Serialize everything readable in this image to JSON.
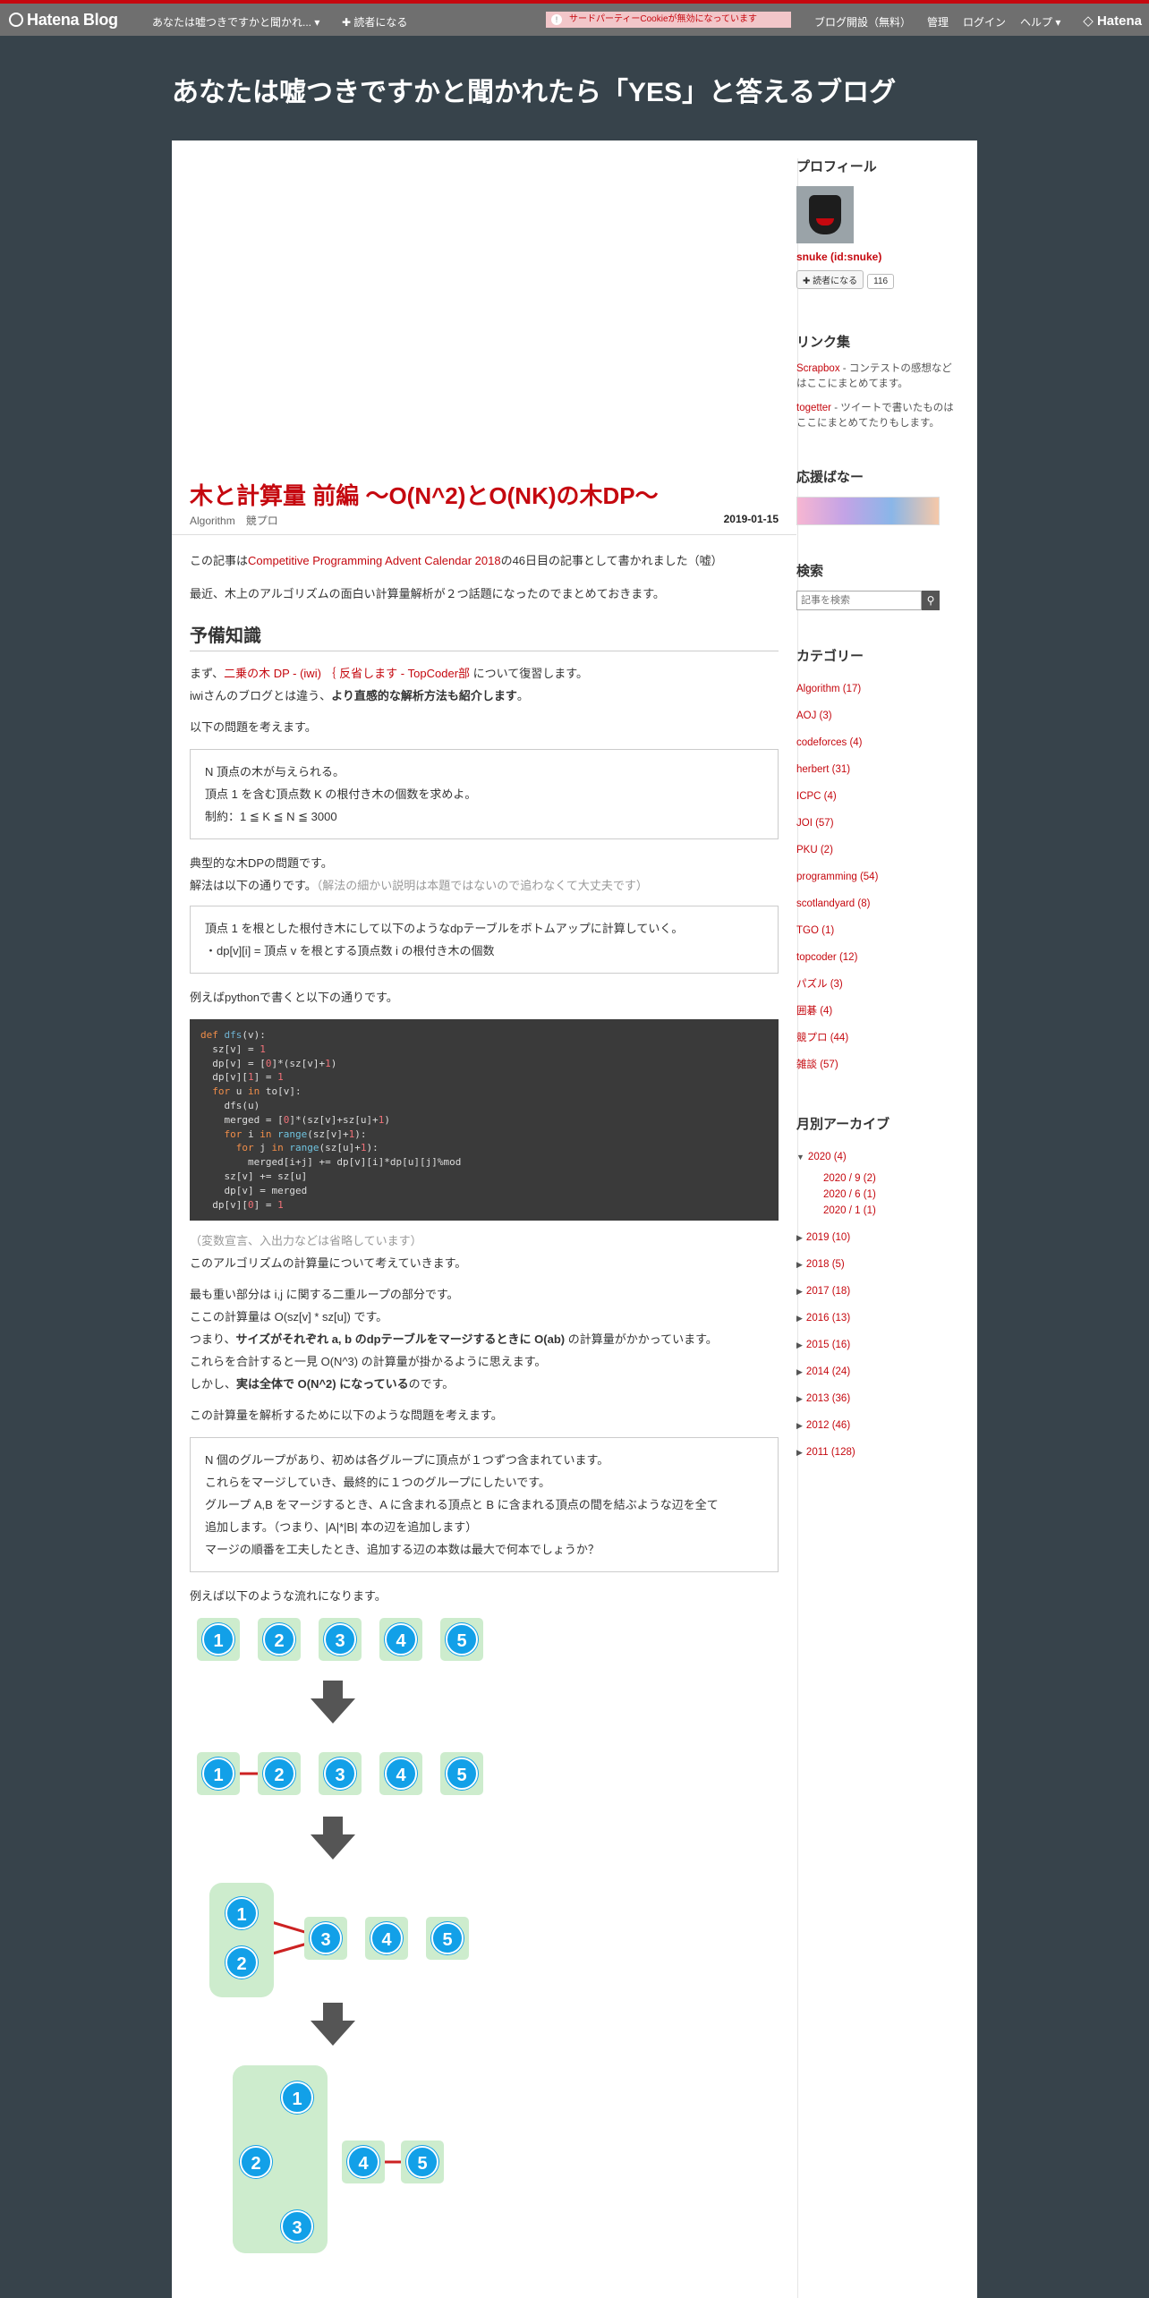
{
  "topbar": {
    "logo": "Hatena Blog",
    "blog_short": "あなたは嘘つきですかと聞かれ...",
    "reader": "読者になる",
    "cookie_notice": "サードパーティーCookieが無効になっています",
    "open_blog": "ブログ開設（無料）",
    "admin": "管理",
    "login": "ログイン",
    "help": "ヘルプ",
    "hatena": "Hatena"
  },
  "blog_title": "あなたは嘘つきですかと聞かれたら「YES」と答えるブログ",
  "entry": {
    "title": "木と計算量 前編 〜O(N^2)とO(NK)の木DP〜",
    "categories": [
      "Algorithm",
      "競プロ"
    ],
    "date": "2019-01-15",
    "p1_pre": "この記事は",
    "p1_link": "Competitive Programming Advent Calendar 2018",
    "p1_post": "の46日目の記事として書かれました（嘘）",
    "p2": "最近、木上のアルゴリズムの面白い計算量解析が２つ話題になったのでまとめておきます。",
    "h_prep": "予備知識",
    "p3_pre": "まず、",
    "p3_link1": "二乗の木 DP - (iwi) ｛ 反省します - TopCoder部",
    "p3_post": " について復習します。",
    "p3b_pre": "iwiさんのブログとは違う、",
    "p3b_bold": "より直感的な解析方法も紹介します",
    "p3b_post": "。",
    "p4": "以下の問題を考えます。",
    "box1": [
      "N 頂点の木が与えられる。",
      "頂点 1 を含む頂点数 K の根付き木の個数を求めよ。",
      "制約：1 ≦ K ≦ N ≦ 3000"
    ],
    "p5a": "典型的な木DPの問題です。",
    "p5b": "解法は以下の通りです。",
    "p5b_note": "（解法の細かい説明は本題ではないので追わなくて大丈夫です）",
    "box2": [
      "頂点 1 を根とした根付き木にして以下のようなdpテーブルをボトムアップに計算していく。",
      "・dp[v][i] = 頂点 v を根とする頂点数 i の根付き木の個数"
    ],
    "p6": "例えばpythonで書くと以下の通りです。",
    "code_note": "（変数宣言、入出力などは省略しています）",
    "p7": "このアルゴリズムの計算量について考えていきます。",
    "p8a": "最も重い部分は i,j に関する二重ループの部分です。",
    "p8b": "ここの計算量は O(sz[v] * sz[u]) です。",
    "p8c_pre": "つまり、",
    "p8c_bold": "サイズがそれぞれ a, b のdpテーブルをマージするときに O(ab)",
    "p8c_post": " の計算量がかかっています。",
    "p8d": "これらを合計すると一見 O(N^3) の計算量が掛かるように思えます。",
    "p8e_pre": "しかし、",
    "p8e_bold": "実は全体で O(N^2) になっている",
    "p8e_post": "のです。",
    "p9": "この計算量を解析するために以下のような問題を考えます。",
    "box3": [
      "N 個のグループがあり、初めは各グループに頂点が１つずつ含まれています。",
      "これらをマージしていき、最終的に１つのグループにしたいです。",
      "グループ A,B をマージするとき、A に含まれる頂点と B に含まれる頂点の間を結ぶような辺を全て",
      "追加します。（つまり、|A|*|B| 本の辺を追加します）",
      "マージの順番を工夫したとき、追加する辺の本数は最大で何本でしょうか？"
    ],
    "p10": "例えば以下のような流れになります。"
  },
  "diagram": {
    "node_color": "#12a0e8",
    "group_color": "#cdeccd",
    "edge_color": "#cc2222",
    "row1": [
      "1",
      "2",
      "3",
      "4",
      "5"
    ],
    "row2": [
      "1",
      "2",
      "3",
      "4",
      "5"
    ],
    "row3": [
      "1",
      "2",
      "3",
      "4",
      "5"
    ],
    "row4": [
      "1",
      "2",
      "3",
      "4",
      "5"
    ]
  },
  "sidebar": {
    "profile_h": "プロフィール",
    "profile_name": "snuke (id:snuke)",
    "reader_btn": "読者になる",
    "reader_count": "116",
    "links_h": "リンク集",
    "links": [
      {
        "name": "Scrapbox",
        "desc": " - コンテストの感想などはここにまとめてます。"
      },
      {
        "name": "togetter",
        "desc": " - ツイートで書いたものはここにまとめてたりもします。"
      }
    ],
    "banner_h": "応援ばなー",
    "search_h": "検索",
    "search_placeholder": "記事を検索",
    "categories_h": "カテゴリー",
    "categories": [
      "Algorithm (17)",
      "AOJ (3)",
      "codeforces (4)",
      "herbert (31)",
      "ICPC (4)",
      "JOI (57)",
      "PKU (2)",
      "programming (54)",
      "scotlandyard (8)",
      "TGO (1)",
      "topcoder (12)",
      "パズル (3)",
      "囲碁 (4)",
      "競プロ (44)",
      "雑談 (57)"
    ],
    "archive_h": "月別アーカイブ",
    "archive_open": "2020 (4)",
    "archive_months": [
      "2020 / 9 (2)",
      "2020 / 6 (1)",
      "2020 / 1 (1)"
    ],
    "archive_years": [
      "2019 (10)",
      "2018 (5)",
      "2017 (18)",
      "2016 (13)",
      "2015 (16)",
      "2014 (24)",
      "2013 (36)",
      "2012 (46)",
      "2011 (128)"
    ]
  }
}
